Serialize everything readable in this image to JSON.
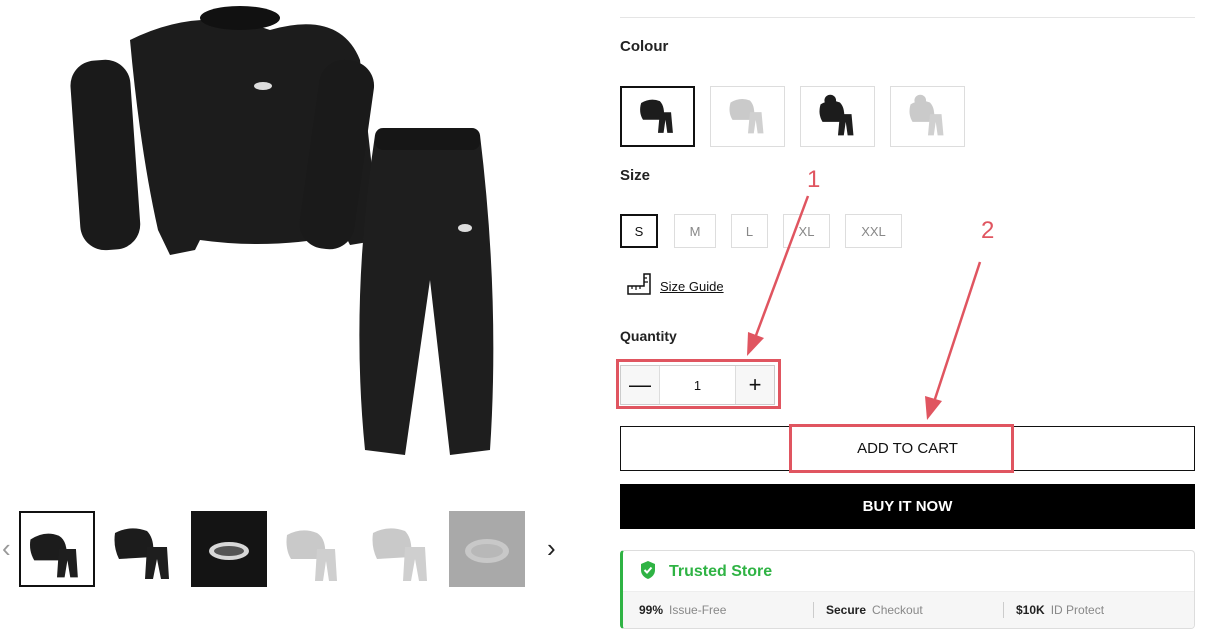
{
  "gallery": {
    "prev_glyph": "‹",
    "next_glyph": "›",
    "thumbnails": [
      "black-set",
      "black-set-alt",
      "black-logo-closeup",
      "grey-set",
      "grey-set-alt",
      "grey-logo-closeup"
    ]
  },
  "colour": {
    "label": "Colour",
    "swatches": [
      "black-crew-set",
      "grey-crew-set",
      "black-hoodie-set",
      "grey-hoodie-set"
    ]
  },
  "size": {
    "label": "Size",
    "options": [
      "S",
      "M",
      "L",
      "XL",
      "XXL"
    ],
    "selected": "S",
    "guide_label": "Size Guide"
  },
  "quantity": {
    "label": "Quantity",
    "value": "1",
    "minus_glyph": "—",
    "plus_glyph": "+"
  },
  "actions": {
    "add_to_cart": "ADD TO CART",
    "buy_now": "BUY IT NOW"
  },
  "trusted": {
    "title": "Trusted Store",
    "stat1_bold": "99%",
    "stat1_text": "Issue-Free",
    "stat2_bold": "Secure",
    "stat2_text": "Checkout",
    "stat3_bold": "$10K",
    "stat3_text": "ID Protect"
  },
  "annotations": {
    "label_1": "1",
    "label_2": "2"
  },
  "colors": {
    "accent_green": "#2fb344",
    "annotation_red": "#e05560",
    "garment_black": "#1c1c1c",
    "garment_grey": "#c9c9c9"
  }
}
